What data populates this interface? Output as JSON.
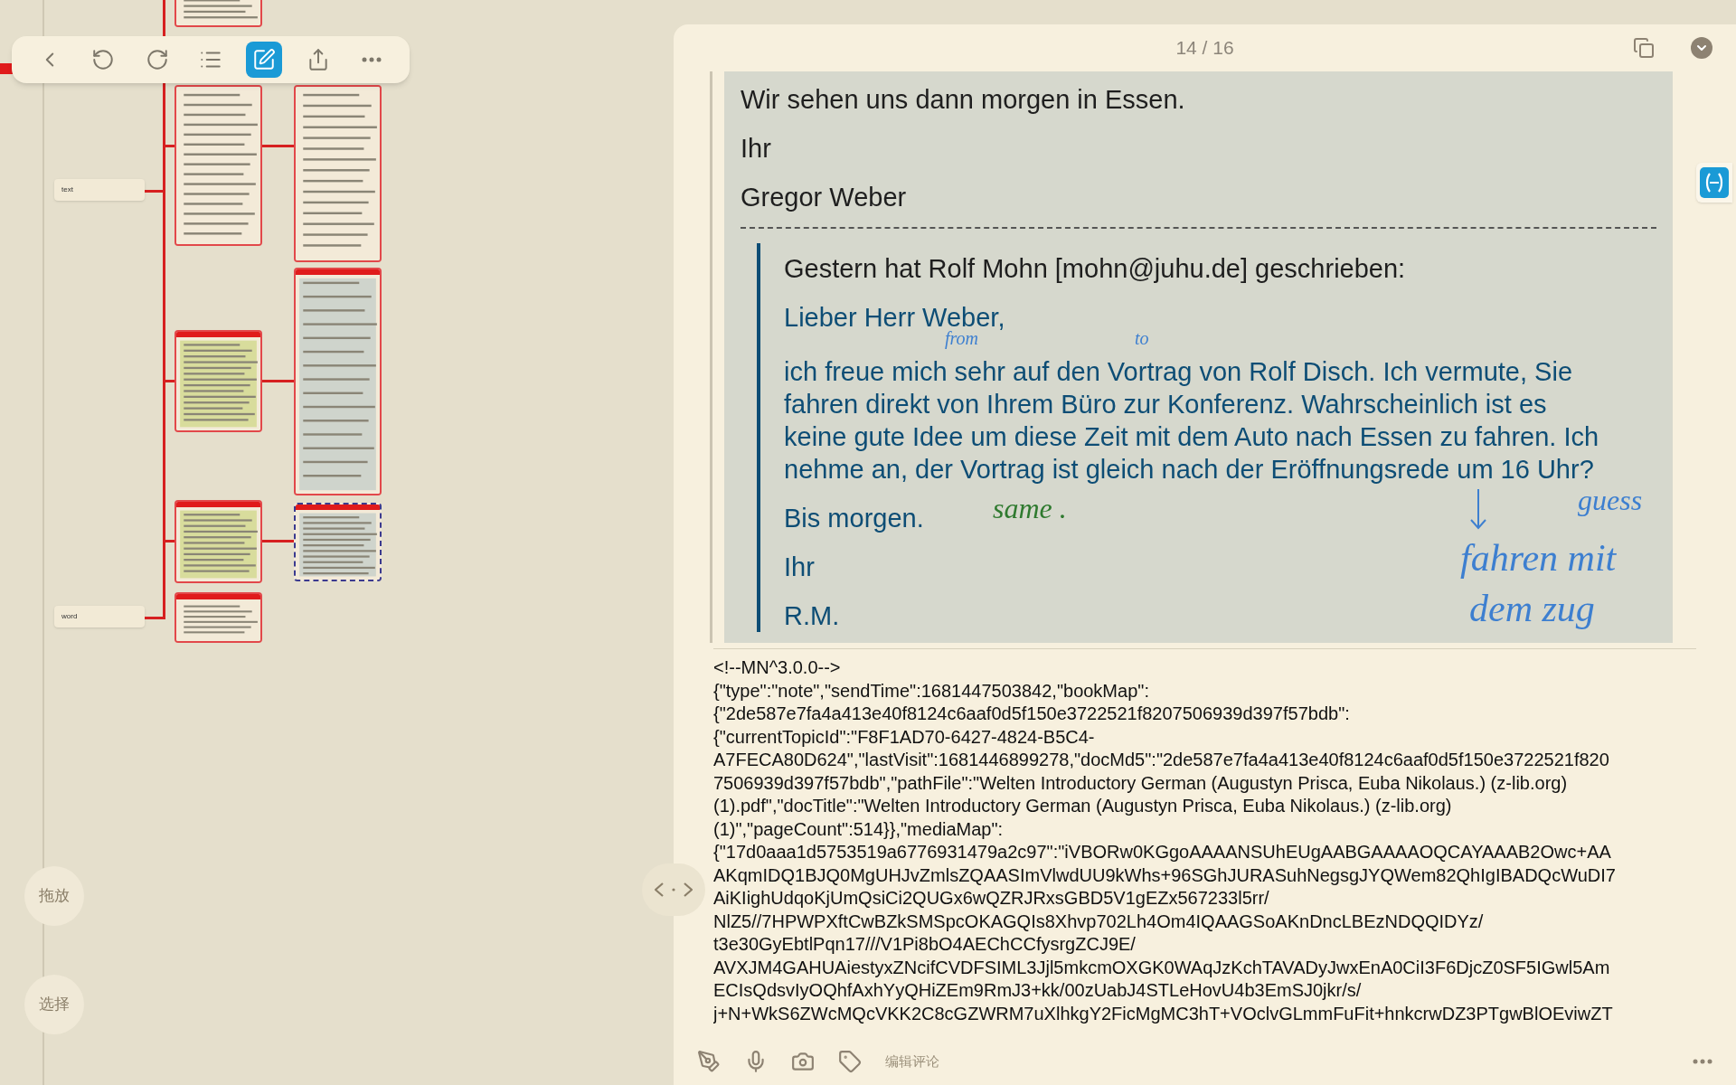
{
  "toolbar": {
    "tools": [
      {
        "kind": "back",
        "selected": false
      },
      {
        "kind": "undo",
        "selected": false
      },
      {
        "kind": "redo",
        "selected": false
      },
      {
        "kind": "outline",
        "selected": false
      },
      {
        "kind": "edit",
        "selected": true
      },
      {
        "kind": "share",
        "selected": false
      },
      {
        "kind": "more",
        "selected": false
      }
    ]
  },
  "mindmap": {
    "nodes": [
      {
        "label": "text"
      },
      {
        "label": "word"
      }
    ],
    "cards": [
      {
        "kind": "picture",
        "selected": false
      },
      {
        "kind": "picture",
        "selected": false
      },
      {
        "kind": "picture",
        "selected": false
      },
      {
        "kind": "picture",
        "selected": false
      },
      {
        "kind": "picture",
        "selected": false
      },
      {
        "kind": "picture",
        "selected": false
      },
      {
        "kind": "picture",
        "selected": false
      },
      {
        "kind": "picture",
        "selected": true
      }
    ]
  },
  "side_buttons": [
    {
      "label": "拖放"
    },
    {
      "label": "选择"
    }
  ],
  "note": {
    "page": "14 / 16",
    "letter": {
      "closing": [
        "Wir sehen uns dann morgen in Essen.",
        "Ihr",
        "Gregor Weber"
      ],
      "quote_header": "Gestern hat Rolf Mohn [mohn@juhu.de] geschrieben:",
      "quote": [
        "Lieber Herr Weber,",
        "ich freue mich sehr auf den Vortrag von Rolf Disch. Ich vermute, Sie fahren direkt von Ihrem Büro zur Konferenz. Wahrscheinlich ist es keine gute Idee um diese Zeit mit dem Auto nach Essen zu fahren. Ich nehme an, der Vortrag ist gleich nach der Eröffnungsrede um 16 Uhr?",
        "Bis morgen.",
        "Ihr",
        "R.M."
      ],
      "handwriting": [
        {
          "text": "from",
          "color": "#3d7fd0"
        },
        {
          "text": "to",
          "color": "#3d7fd0"
        },
        {
          "text": "same .",
          "color": "#2f7a2f"
        },
        {
          "text": "guess",
          "color": "#3d7fd0"
        },
        {
          "text": "fahren mit",
          "color": "#3d7fd0"
        },
        {
          "text": "dem zug",
          "color": "#3d7fd0"
        }
      ]
    },
    "code_lines": [
      "<!--MN^3.0.0-->",
      "{\"type\":\"note\",\"sendTime\":1681447503842,\"bookMap\":",
      "{\"2de587e7fa4a413e40f8124c6aaf0d5f150e3722521f8207506939d397f57bdb\":",
      "{\"currentTopicId\":\"F8F1AD70-6427-4824-B5C4-",
      "A7FECA80D624\",\"lastVisit\":1681446899278,\"docMd5\":\"2de587e7fa4a413e40f8124c6aaf0d5f150e3722521f820",
      "7506939d397f57bdb\",\"pathFile\":\"Welten Introductory German (Augustyn Prisca, Euba Nikolaus.) (z-lib.org)",
      "(1).pdf\",\"docTitle\":\"Welten Introductory German (Augustyn Prisca, Euba Nikolaus.) (z-lib.org)",
      "(1)\",\"pageCount\":514}},\"mediaMap\":",
      "{\"17d0aaa1d5753519a6776931479a2c97\":\"iVBORw0KGgoAAAANSUhEUgAABGAAAAOQCAYAAAB2Owc+AA",
      "AKqmIDQ1BJQ0MgUHJvZmlsZQAASImVlwdUU9kWhs+96SGhJURASuhNegsgJYQWem82QhIgIBADQcWuDI7",
      "AiKIighUdqoKjUmQsiCi2QUGx6wQZRJRxsGBD5V1gEZx567233l5rr/",
      "NlZ5//7HPWPXftCwBZkSMSpcOKAGQIs8Xhvp702Lh4Om4IQAAGSoAKnDncLBEzNDQQIDYz/",
      "t3e30GyEbtlPqn17///V1Pi8bO4AEChCCfysrgZCJ9E/",
      "AVXJM4GAHUAiestyxZNcifCVDFSIML3Jjl5mkcmOXGK0WAqJzKchTAVADyJwxEnA0CiI3F6DjcZ0SF5IGwl5Am",
      "ECIsQdsvIyOQhfAxhYyQHiZEm9RmJ3+kk/00zUabJ4STLeHovU4b3EmSJ0jkr/s/",
      "j+N+WkS6ZWcMQcVKK2C8cGZWRM7uXlhkgY2FicMgMC3hT+VOclvGLmmFuFit+hnkcrwDZ3PTgwBlOEviwZT"
    ]
  },
  "bottom_bar": {
    "placeholder": "编辑评论"
  }
}
